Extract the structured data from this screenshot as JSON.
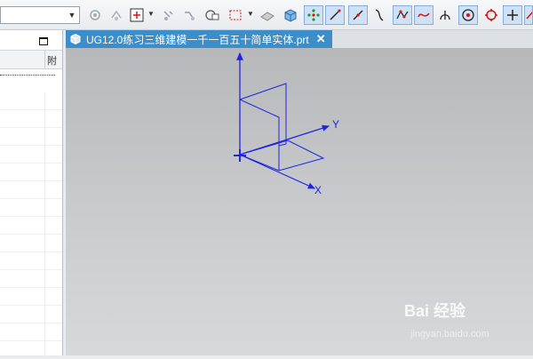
{
  "toolbar": {
    "combo_value": "",
    "icons": [
      "assembly-icon",
      "move-icon",
      "snap-point-icon",
      "dropdown",
      "show-hide-icon",
      "hide-icon",
      "select-body-icon",
      "rectangle-select-icon",
      "dropdown",
      "shaded-view-icon",
      "solid-view-icon",
      "point-snap-icon",
      "line-icon",
      "line-selected-icon",
      "arc-icon",
      "spline-icon",
      "curve-icon",
      "tangent-icon",
      "circle-center-icon",
      "quadrant-icon",
      "cross-icon",
      "extra-icon"
    ]
  },
  "left_panel": {
    "column2_header": "附"
  },
  "document_tab": {
    "label": "UG12.0练习三维建模一千一百五十简单实体.prt",
    "close_glyph": "✕"
  },
  "viewport": {
    "axis_labels": {
      "x": "X",
      "y": "Y"
    }
  },
  "watermark": {
    "brand": "Bai 经验",
    "url": "jingyan.baidu.com"
  },
  "colors": {
    "tab_active": "#3b8ec9",
    "sketch": "#2323e0",
    "viewport_top": "#b6b8ba",
    "viewport_bottom": "#d6d8da"
  }
}
